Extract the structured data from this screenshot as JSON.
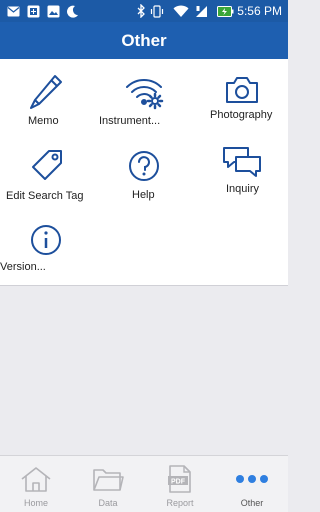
{
  "status_bar": {
    "time": "5:56 PM",
    "icons": [
      "mail-icon",
      "sim-icon",
      "image-icon",
      "moon-icon",
      "bluetooth-icon",
      "vibrate-icon",
      "wifi-icon",
      "signal-icon",
      "battery-charging-icon"
    ]
  },
  "header": {
    "title": "Other"
  },
  "grid": {
    "items": [
      {
        "id": "memo",
        "label": "Memo",
        "icon": "pencil-icon"
      },
      {
        "id": "instrument",
        "label": "Instrument...",
        "icon": "wifi-gear-icon"
      },
      {
        "id": "photography",
        "label": "Photography",
        "icon": "camera-icon"
      },
      {
        "id": "edit-search-tag",
        "label": "Edit Search Tag",
        "icon": "tag-icon"
      },
      {
        "id": "help",
        "label": "Help",
        "icon": "question-icon"
      },
      {
        "id": "inquiry",
        "label": "Inquiry",
        "icon": "chat-bubbles-icon"
      },
      {
        "id": "version",
        "label": "Version...",
        "icon": "info-icon"
      }
    ]
  },
  "bottom_nav": {
    "active": "Other",
    "items": [
      {
        "label": "Home",
        "icon": "home-icon"
      },
      {
        "label": "Data",
        "icon": "folder-icon"
      },
      {
        "label": "Report",
        "icon": "pdf-icon",
        "icon_text": "PDF"
      },
      {
        "label": "Other",
        "icon": "more-dots-icon"
      }
    ]
  },
  "colors": {
    "brand": "#1e5fb0",
    "icon_stroke": "#1d4f9c",
    "active_dots": "#2f7fe0"
  }
}
